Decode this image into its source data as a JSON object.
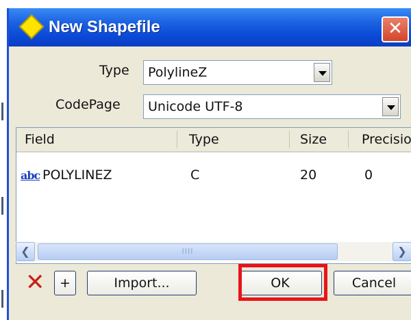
{
  "window": {
    "title": "New Shapefile",
    "close_label": "✕"
  },
  "form": {
    "type_label": "Type",
    "type_value": "PolylineZ",
    "codepage_label": "CodePage",
    "codepage_value": "Unicode UTF-8"
  },
  "fields_table": {
    "columns": [
      "Field",
      "Type",
      "Size",
      "Precisio"
    ],
    "rows": [
      {
        "icon": "abc",
        "field": "POLYLINEZ",
        "type": "C",
        "size": "20",
        "precision": "0"
      }
    ]
  },
  "scrollbar": {
    "left_arrow": "❮",
    "right_arrow": "❯",
    "grip": "IIII"
  },
  "actions": {
    "delete_icon": "✕",
    "add_label": "+",
    "import_label": "Import...",
    "ok_label": "OK",
    "cancel_label": "Cancel"
  },
  "colors": {
    "titlebar": "#0a48d6",
    "dialog_bg": "#ece9d8",
    "highlight": "#e8141b",
    "delete": "#c91f16"
  }
}
